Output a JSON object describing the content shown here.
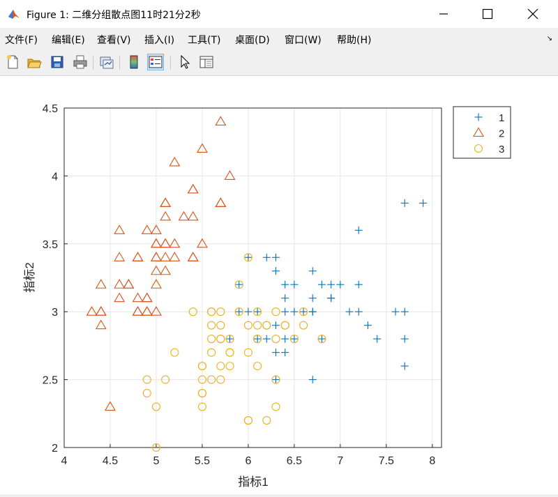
{
  "window": {
    "title": "Figure 1: 二维分组散点图11时21分2秒"
  },
  "menu": [
    "文件(F)",
    "编辑(E)",
    "查看(V)",
    "插入(I)",
    "工具(T)",
    "桌面(D)",
    "窗口(W)",
    "帮助(H)"
  ],
  "toolbar": [
    "new-figure-icon",
    "open-file-icon",
    "save-icon",
    "print-icon",
    "link-plot-icon",
    "colorbar-icon",
    "legend-icon",
    "pointer-icon",
    "property-inspector-icon"
  ],
  "colors": {
    "g1": "#0072bd",
    "g2": "#d95319",
    "g3": "#edb120"
  },
  "chart_data": {
    "type": "scatter",
    "xlabel": "指标1",
    "ylabel": "指标2",
    "xlim": [
      4,
      8.1
    ],
    "ylim": [
      2,
      4.5
    ],
    "xticks": [
      "4",
      "4.5",
      "5",
      "5.5",
      "6",
      "6.5",
      "7",
      "7.5",
      "8"
    ],
    "yticks": [
      "2",
      "2.5",
      "3",
      "3.5",
      "4",
      "4.5"
    ],
    "grid": true,
    "legend_position": "top-right outside",
    "series": [
      {
        "name": "1",
        "marker": "plus",
        "points": [
          [
            7.0,
            3.2
          ],
          [
            6.4,
            3.2
          ],
          [
            6.9,
            3.1
          ],
          [
            6.5,
            2.8
          ],
          [
            6.3,
            3.3
          ],
          [
            6.6,
            3.0
          ],
          [
            5.9,
            3.2
          ],
          [
            6.1,
            2.8
          ],
          [
            6.7,
            3.1
          ],
          [
            6.3,
            2.5
          ],
          [
            6.8,
            2.8
          ],
          [
            6.7,
            3.0
          ],
          [
            6.3,
            3.4
          ],
          [
            6.0,
            3.4
          ],
          [
            6.4,
            3.1
          ],
          [
            6.2,
            3.4
          ],
          [
            6.7,
            3.3
          ],
          [
            6.5,
            3.0
          ],
          [
            6.8,
            3.2
          ],
          [
            6.9,
            3.2
          ],
          [
            7.1,
            3.0
          ],
          [
            7.2,
            3.6
          ],
          [
            7.2,
            3.2
          ],
          [
            7.7,
            3.8
          ],
          [
            7.9,
            3.8
          ],
          [
            7.7,
            2.6
          ],
          [
            7.7,
            2.8
          ],
          [
            7.7,
            3.0
          ],
          [
            7.6,
            3.0
          ],
          [
            7.2,
            3.0
          ],
          [
            7.3,
            2.9
          ],
          [
            7.4,
            2.8
          ],
          [
            6.4,
            2.8
          ],
          [
            6.1,
            3.0
          ],
          [
            6.3,
            2.9
          ],
          [
            6.3,
            2.7
          ],
          [
            6.4,
            2.7
          ],
          [
            6.2,
            2.8
          ],
          [
            5.8,
            2.8
          ],
          [
            5.9,
            3.0
          ],
          [
            6.0,
            3.0
          ],
          [
            6.7,
            2.5
          ],
          [
            6.9,
            3.1
          ],
          [
            6.5,
            3.2
          ],
          [
            6.4,
            3.0
          ],
          [
            6.7,
            3.0
          ]
        ]
      },
      {
        "name": "2",
        "marker": "triangle",
        "points": [
          [
            5.1,
            3.5
          ],
          [
            4.9,
            3.0
          ],
          [
            4.7,
            3.2
          ],
          [
            4.6,
            3.1
          ],
          [
            5.0,
            3.6
          ],
          [
            5.4,
            3.9
          ],
          [
            4.6,
            3.4
          ],
          [
            5.0,
            3.4
          ],
          [
            4.4,
            2.9
          ],
          [
            4.9,
            3.1
          ],
          [
            5.4,
            3.7
          ],
          [
            4.8,
            3.4
          ],
          [
            4.8,
            3.0
          ],
          [
            4.3,
            3.0
          ],
          [
            5.8,
            4.0
          ],
          [
            5.7,
            4.4
          ],
          [
            5.4,
            3.9
          ],
          [
            5.1,
            3.5
          ],
          [
            5.7,
            3.8
          ],
          [
            5.1,
            3.8
          ],
          [
            5.4,
            3.4
          ],
          [
            5.1,
            3.7
          ],
          [
            4.6,
            3.6
          ],
          [
            5.1,
            3.3
          ],
          [
            4.8,
            3.4
          ],
          [
            5.0,
            3.0
          ],
          [
            5.0,
            3.4
          ],
          [
            5.2,
            3.5
          ],
          [
            5.2,
            3.4
          ],
          [
            4.7,
            3.2
          ],
          [
            4.8,
            3.1
          ],
          [
            5.4,
            3.4
          ],
          [
            5.2,
            4.1
          ],
          [
            5.5,
            4.2
          ],
          [
            4.9,
            3.1
          ],
          [
            5.0,
            3.2
          ],
          [
            5.5,
            3.5
          ],
          [
            4.4,
            3.0
          ],
          [
            5.1,
            3.4
          ],
          [
            5.0,
            3.5
          ],
          [
            4.5,
            2.3
          ],
          [
            4.4,
            3.2
          ],
          [
            5.0,
            3.5
          ],
          [
            5.1,
            3.8
          ],
          [
            4.8,
            3.0
          ],
          [
            4.6,
            3.2
          ],
          [
            5.3,
            3.7
          ],
          [
            5.0,
            3.3
          ],
          [
            4.9,
            3.6
          ],
          [
            5.7,
            3.8
          ],
          [
            4.4,
            3.0
          ],
          [
            4.9,
            3.0
          ]
        ]
      },
      {
        "name": "3",
        "marker": "circle",
        "points": [
          [
            5.5,
            2.3
          ],
          [
            5.7,
            2.8
          ],
          [
            4.9,
            2.4
          ],
          [
            5.2,
            2.7
          ],
          [
            5.0,
            2.0
          ],
          [
            5.9,
            3.0
          ],
          [
            6.0,
            2.2
          ],
          [
            5.6,
            2.9
          ],
          [
            5.6,
            3.0
          ],
          [
            5.8,
            2.7
          ],
          [
            6.2,
            2.2
          ],
          [
            5.6,
            2.5
          ],
          [
            5.9,
            3.2
          ],
          [
            6.1,
            2.8
          ],
          [
            6.4,
            2.9
          ],
          [
            6.6,
            3.0
          ],
          [
            6.8,
            2.8
          ],
          [
            6.0,
            2.9
          ],
          [
            5.7,
            2.6
          ],
          [
            5.5,
            2.4
          ],
          [
            5.5,
            2.4
          ],
          [
            5.8,
            2.7
          ],
          [
            6.0,
            2.7
          ],
          [
            5.4,
            3.0
          ],
          [
            6.0,
            3.4
          ],
          [
            6.3,
            2.3
          ],
          [
            5.6,
            3.0
          ],
          [
            5.5,
            2.5
          ],
          [
            5.5,
            2.6
          ],
          [
            6.1,
            3.0
          ],
          [
            5.8,
            2.6
          ],
          [
            5.0,
            2.3
          ],
          [
            5.6,
            2.7
          ],
          [
            5.7,
            3.0
          ],
          [
            5.7,
            2.9
          ],
          [
            6.2,
            2.9
          ],
          [
            5.1,
            2.5
          ],
          [
            5.7,
            2.8
          ],
          [
            4.9,
            2.5
          ],
          [
            6.0,
            2.2
          ],
          [
            6.3,
            2.5
          ],
          [
            6.1,
            2.6
          ],
          [
            6.5,
            2.8
          ],
          [
            6.3,
            2.8
          ],
          [
            6.1,
            2.9
          ],
          [
            6.4,
            2.9
          ],
          [
            6.2,
            2.9
          ],
          [
            5.6,
            2.8
          ],
          [
            5.5,
            2.6
          ],
          [
            5.8,
            2.8
          ],
          [
            6.1,
            2.8
          ],
          [
            6.6,
            2.9
          ],
          [
            6.3,
            3.0
          ],
          [
            5.7,
            2.5
          ]
        ]
      }
    ]
  }
}
